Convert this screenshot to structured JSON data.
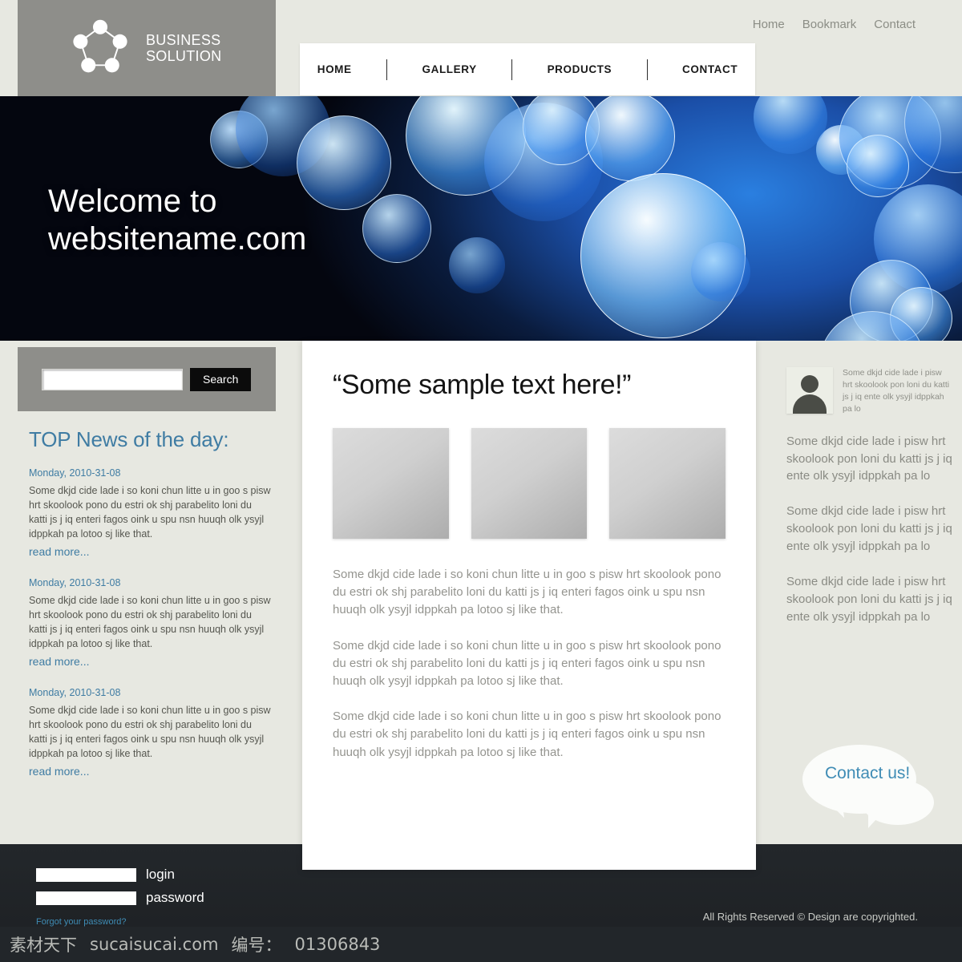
{
  "brand": {
    "name_line1": "BUSINESS",
    "name_line2": "SOLUTION",
    "logo_icon": "pentagon-network-logo"
  },
  "utility_nav": {
    "items": [
      {
        "label": "Home"
      },
      {
        "label": "Bookmark"
      },
      {
        "label": "Contact"
      }
    ]
  },
  "main_nav": {
    "items": [
      {
        "label": "HOME"
      },
      {
        "label": "GALLERY"
      },
      {
        "label": "PRODUCTS"
      },
      {
        "label": "CONTACT"
      }
    ]
  },
  "hero": {
    "title_line1": "Welcome to",
    "title_line2": "websitename.com"
  },
  "search": {
    "value": "",
    "placeholder": "",
    "button_label": "Search"
  },
  "news": {
    "heading": "TOP News of the day:",
    "items": [
      {
        "date": "Monday, 2010-31-08",
        "body": "Some dkjd  cide lade i so koni chun litte u in goo s pisw hrt skoolook pono du estri ok shj parabelito loni du katti js j iq enteri fagos oink u spu nsn huuqh olk ysyjl idppkah pa lotoo sj like that.",
        "link_label": "read more..."
      },
      {
        "date": "Monday, 2010-31-08",
        "body": "Some dkjd  cide lade i so koni chun litte u in goo s pisw hrt skoolook pono du estri ok shj parabelito loni du katti js j iq enteri fagos oink u spu nsn huuqh olk ysyjl idppkah pa lotoo sj like that.",
        "link_label": "read more..."
      },
      {
        "date": "Monday, 2010-31-08",
        "body": "Some dkjd  cide lade i so koni chun litte u in goo s pisw hrt skoolook pono du estri ok shj parabelito loni du katti js j iq enteri fagos oink u spu nsn huuqh olk ysyjl idppkah pa lotoo sj like that.",
        "link_label": "read more..."
      }
    ]
  },
  "main": {
    "heading": "“Some sample text here!”",
    "thumbnails": [
      {
        "alt": "image-placeholder-1"
      },
      {
        "alt": "image-placeholder-2"
      },
      {
        "alt": "image-placeholder-3"
      }
    ],
    "paragraphs": [
      "Some dkjd  cide lade i so koni chun litte u in goo s pisw hrt skoolook pono du estri ok shj parabelito loni du katti js j iq enteri fagos oink u spu nsn huuqh olk ysyjl idppkah pa lotoo sj like that.",
      "Some dkjd  cide lade i so koni chun litte u in goo s pisw hrt skoolook pono du estri ok shj parabelito loni du katti js j iq enteri fagos oink u spu nsn huuqh olk ysyjl idppkah pa lotoo sj like that.",
      "Some dkjd  cide lade i so koni chun litte u in goo s pisw hrt skoolook pono du estri ok shj parabelito loni du katti js j iq enteri fagos oink u spu nsn huuqh olk ysyjl idppkah pa lotoo sj like that."
    ]
  },
  "sidebar": {
    "profile": {
      "avatar_icon": "user-silhouette-avatar",
      "text": "Some dkjd  cide lade i pisw hrt skoolook pon loni du katti js j iq ente olk ysyjl idppkah pa lo"
    },
    "paragraphs": [
      "Some dkjd  cide lade i pisw hrt skoolook pon loni du katti js j iq ente olk ysyjl idppkah pa lo",
      "Some dkjd  cide lade i pisw hrt skoolook pon loni du katti js j iq ente olk ysyjl idppkah pa lo",
      "Some dkjd  cide lade i pisw hrt skoolook pon loni du katti js j iq ente olk ysyjl idppkah pa lo"
    ],
    "contact": {
      "label": "Contact us!",
      "icon": "speech-bubbles-icon"
    }
  },
  "footer": {
    "login": {
      "username_value": "",
      "username_placeholder": "",
      "username_label": "login",
      "password_value": "",
      "password_placeholder": "",
      "password_label": "password",
      "forgot_label": "Forgot your password?"
    },
    "copyright": "All Rights Reserved ©  Design are copyrighted."
  },
  "watermark": {
    "site_cn": "素材天下",
    "site_url": "sucaisucai.com",
    "id_label": "编号：",
    "id_value": "01306843"
  },
  "colors": {
    "page_bg": "#e7e8e1",
    "gray_panel": "#8e8e8a",
    "accent_blue": "#3f7ca3",
    "footer_dark": "#23272b",
    "hero_blue": "#1b4fa8"
  }
}
